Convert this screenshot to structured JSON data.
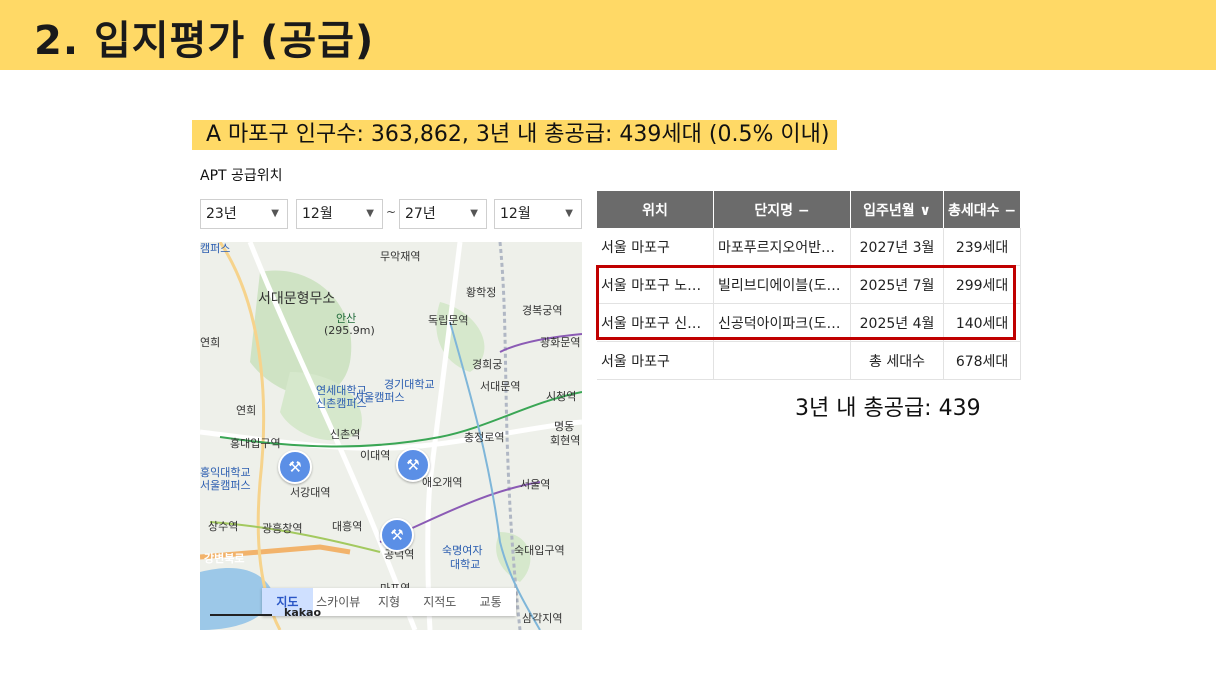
{
  "header": {
    "title": "2. 입지평가 (공급)"
  },
  "summary": {
    "text": "A 마포구 인구수: 363,862,  3년 내 총공급: 439세대 (0.5% 이내)"
  },
  "filter": {
    "label": "APT 공급위치",
    "start_year": "23년",
    "start_month": "12월",
    "separator": "~",
    "end_year": "27년",
    "end_month": "12월"
  },
  "map": {
    "tabs": [
      "지도",
      "스카이뷰",
      "지형",
      "지적도",
      "교통"
    ],
    "active_tab": "지도",
    "labels": {
      "seodaemun_prison": "서대문형무소",
      "muakjae": "무악재역",
      "hwanghakjeong": "황학정",
      "ansan": "안산",
      "ansan_height": "(295.9m)",
      "dongnimmun": "독립문역",
      "gyeongbokgung": "경복궁역",
      "gwanghwamun": "광화문역",
      "gyeonghuigung": "경희궁",
      "seodaemun_stn": "서대문역",
      "yonsei": "연세대학교",
      "yonsei2": "신촌캠퍼스",
      "kyonggi": "경기대학교",
      "kyonggi2": "서울캠퍼스",
      "cityhall": "시청역",
      "sinchon": "신촌역",
      "chungjeongno": "충정로역",
      "hoehyeon": "회현역",
      "hongik_stn": "홍대입구역",
      "idae": "이대역",
      "ahyeon": "애오개역",
      "seoul_stn": "서울역",
      "hongik_univ": "홍익대학교",
      "hongik_univ2": "서울캠퍼스",
      "sogang": "서강대역",
      "sangsu": "상수역",
      "gwangheungchang": "광흥창역",
      "daeheung": "대흥역",
      "gongdeok": "공덕역",
      "sookmyung": "숙명여자",
      "sookmyung2": "대학교",
      "sookdae_stn": "숙대입구역",
      "gangbyeon": "강변북로",
      "mapo_stn": "마포역",
      "samgakji": "삼각지역",
      "yeonhui": "연희",
      "yeonhui2": "연희",
      "myeongdong": "명동",
      "campus_top": "캠퍼스",
      "kakao": "kakao"
    }
  },
  "table": {
    "headers": [
      "위치",
      "단지명 −",
      "입주년월 ∨",
      "총세대수 −"
    ],
    "rows": [
      [
        "서울 마포구",
        "마포푸르지오어반…",
        "2027년 3월",
        "239세대"
      ],
      [
        "서울 마포구 노…",
        "빌리브디에이블(도…",
        "2025년 7월",
        "299세대"
      ],
      [
        "서울 마포구 신…",
        "신공덕아이파크(도…",
        "2025년 4월",
        "140세대"
      ],
      [
        "서울 마포구",
        "",
        "총 세대수",
        "678세대"
      ]
    ]
  },
  "note": {
    "text": "3년 내 총공급: 439"
  },
  "colors": {
    "banner": "#ffd966",
    "table_header": "#6b6b6b",
    "highlight_box": "#c00000",
    "map_pin": "#5b8fe6"
  }
}
